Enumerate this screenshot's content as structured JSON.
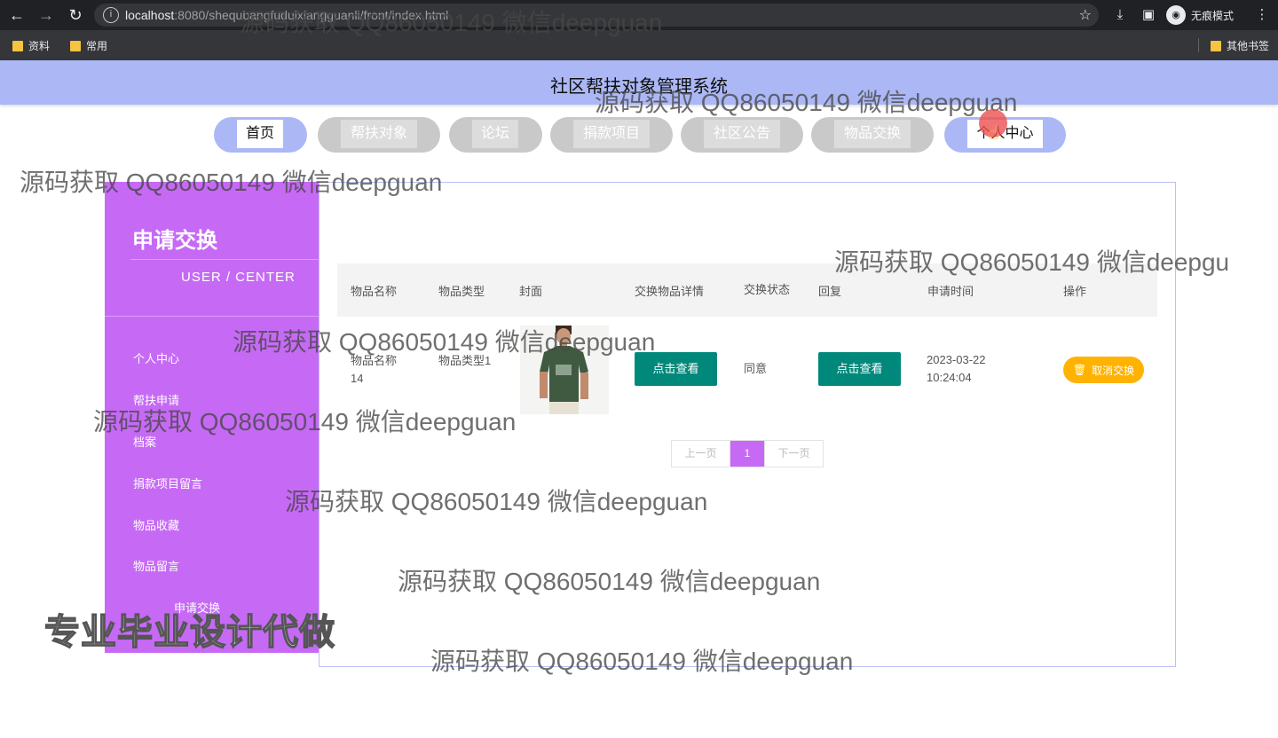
{
  "browser": {
    "url_host": "localhost",
    "url_rest": ":8080/shequbangfuduixiangguanli/front/index.html",
    "incognito_label": "无痕模式",
    "bookmarks": [
      "资料",
      "常用"
    ],
    "other_bookmarks": "其他书签"
  },
  "site": {
    "title": "社区帮扶对象管理系统"
  },
  "nav": {
    "items": [
      "首页",
      "帮扶对象",
      "论坛",
      "捐款项目",
      "社区公告",
      "物品交换",
      "个人中心"
    ]
  },
  "sidebar": {
    "title": "申请交换",
    "subtitle": "USER / CENTER",
    "items": [
      "个人中心",
      "帮扶申请",
      "档案",
      "捐款项目留言",
      "物品收藏",
      "物品留言",
      "申请交换"
    ]
  },
  "table": {
    "headers": [
      "物品名称",
      "物品类型",
      "封面",
      "交换物品详情",
      "交换状态",
      "回复",
      "申请时间",
      "操作"
    ],
    "rows": [
      {
        "name": "物品名称14",
        "type": "物品类型1",
        "detail_button": "点击查看",
        "status": "同意",
        "reply_button": "点击查看",
        "time": "2023-03-22 10:24:04",
        "action": "取消交换"
      }
    ]
  },
  "pagination": {
    "prev": "上一页",
    "current": "1",
    "next": "下一页"
  },
  "watermark": "源码获取 QQ86050149 微信deepguan",
  "watermark_cut": "源码获取 QQ86050149 微信deepgu",
  "promo": "专业毕业设计代做",
  "colors": {
    "header": "#abb8f5",
    "sidebar": "#c66af5",
    "teal_button": "#00897b",
    "cancel_button": "#ffb300"
  }
}
